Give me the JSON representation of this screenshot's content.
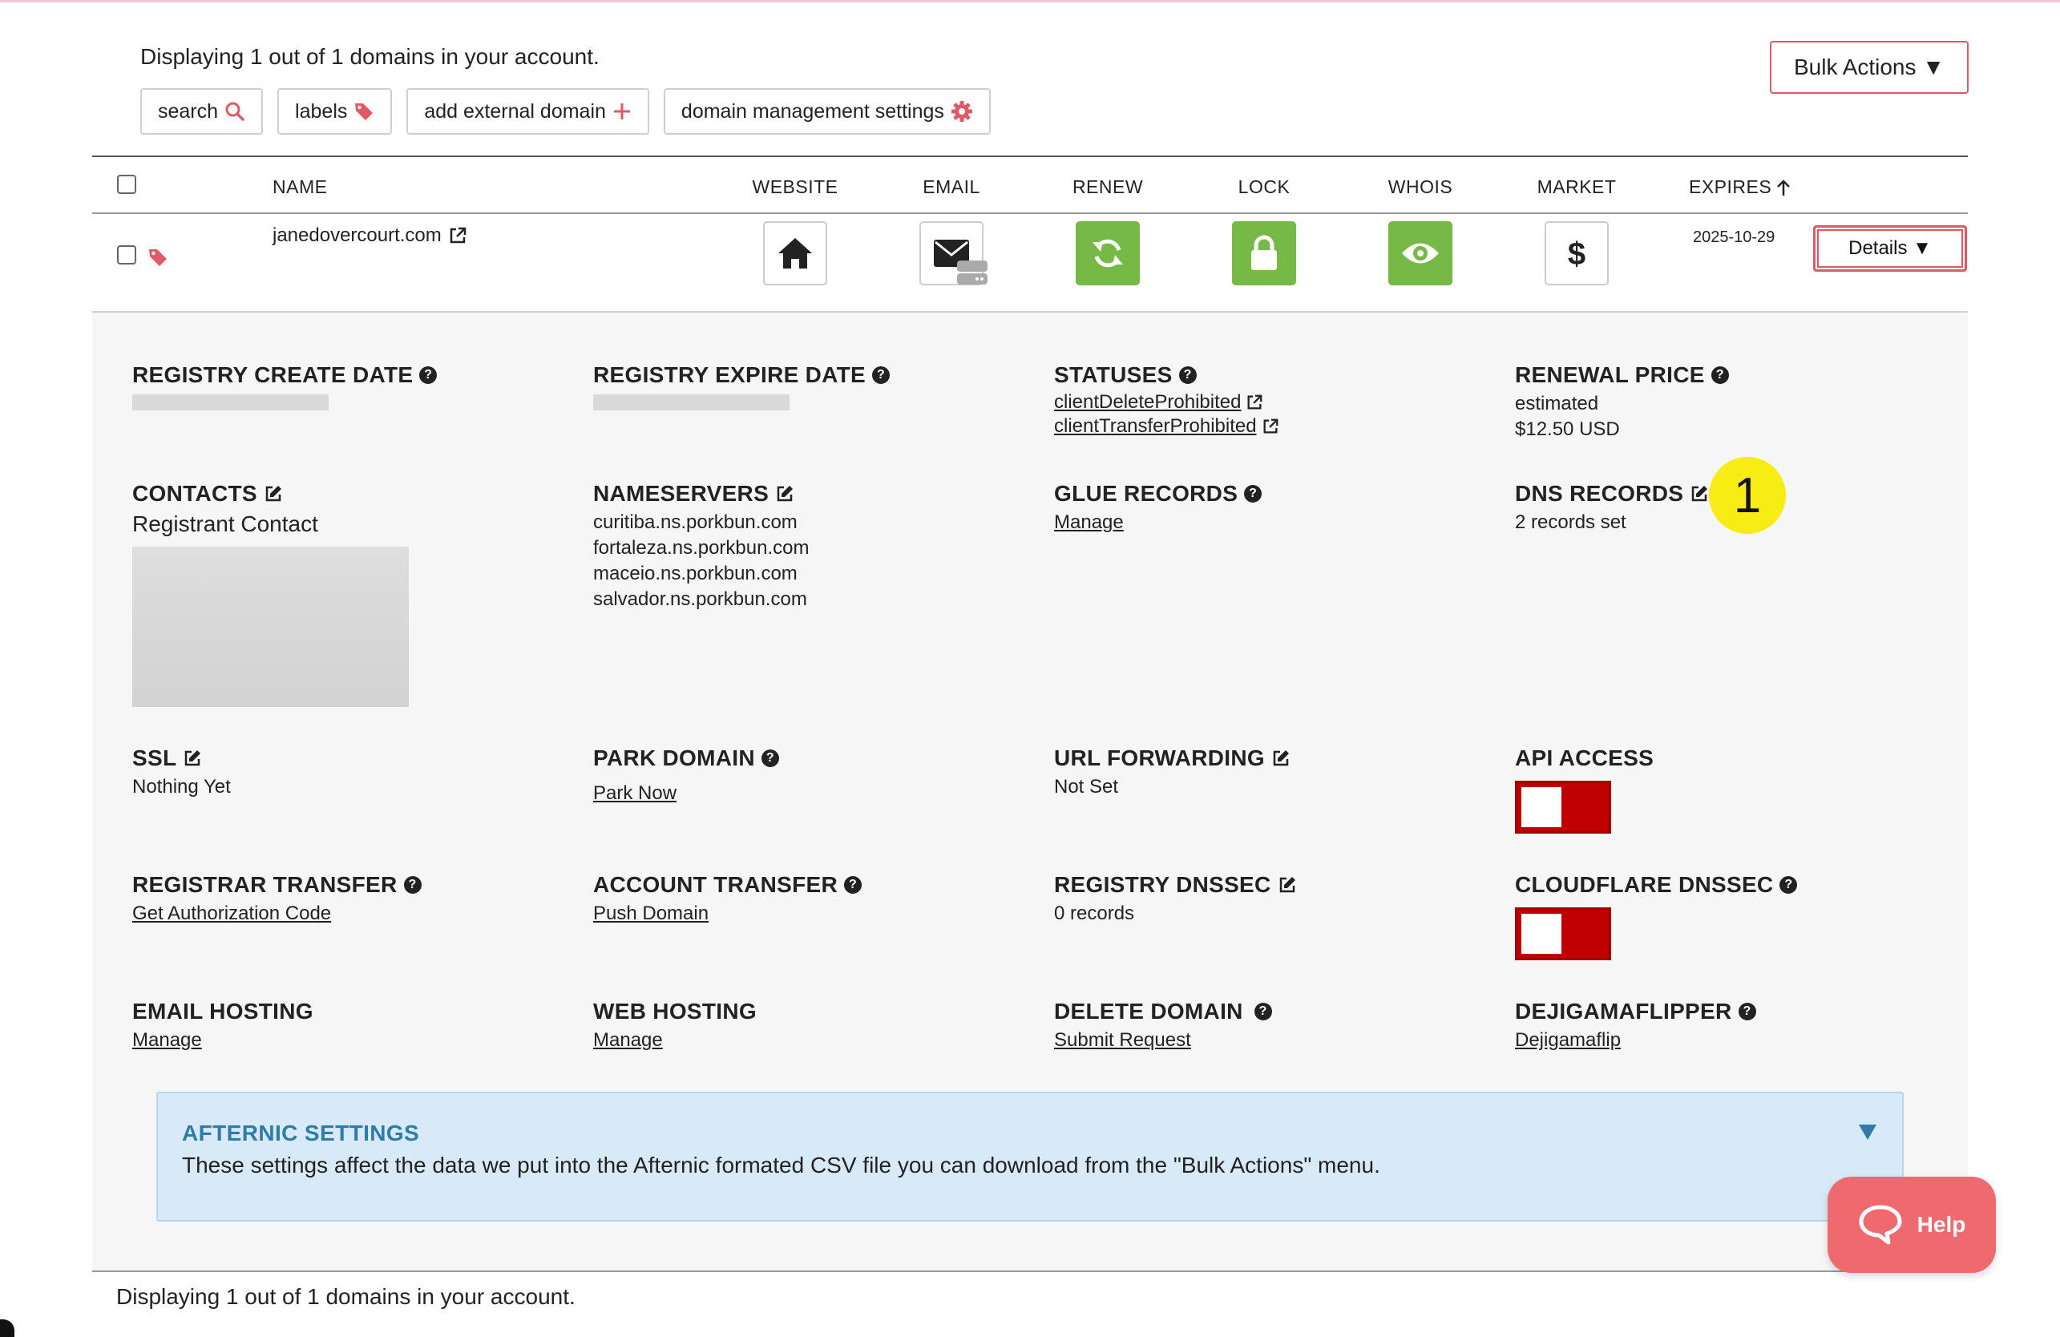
{
  "summary": "Displaying 1 out of 1 domains in your account.",
  "summary_bottom": "Displaying 1 out of 1 domains in your account.",
  "toolbar": {
    "search": "search",
    "labels": "labels",
    "add_external": "add external domain",
    "settings": "domain management settings"
  },
  "bulk_actions": "Bulk Actions ▼",
  "columns": {
    "name": "NAME",
    "website": "WEBSITE",
    "email": "EMAIL",
    "renew": "RENEW",
    "lock": "LOCK",
    "whois": "WHOIS",
    "market": "MARKET",
    "expires": "EXPIRES"
  },
  "domain": {
    "name": "janedovercourt.com",
    "expires": "2025-10-29",
    "details_label": "Details ▼"
  },
  "details": {
    "registry_create_date": "REGISTRY CREATE DATE",
    "registry_expire_date": "REGISTRY EXPIRE DATE",
    "statuses": {
      "title": "STATUSES",
      "items": [
        "clientDeleteProhibited",
        "clientTransferProhibited"
      ]
    },
    "renewal_price": {
      "title": "RENEWAL PRICE",
      "line1": "estimated",
      "line2": "$12.50 USD"
    },
    "contacts": {
      "title": "CONTACTS",
      "sub": "Registrant Contact"
    },
    "nameservers": {
      "title": "NAMESERVERS",
      "items": [
        "curitiba.ns.porkbun.com",
        "fortaleza.ns.porkbun.com",
        "maceio.ns.porkbun.com",
        "salvador.ns.porkbun.com"
      ]
    },
    "glue_records": {
      "title": "GLUE RECORDS",
      "link": "Manage"
    },
    "dns_records": {
      "title": "DNS RECORDS",
      "value": "2 records set"
    },
    "ssl": {
      "title": "SSL",
      "value": "Nothing Yet"
    },
    "park_domain": {
      "title": "PARK DOMAIN",
      "link": "Park Now"
    },
    "url_forwarding": {
      "title": "URL FORWARDING",
      "value": "Not Set"
    },
    "api_access": {
      "title": "API ACCESS",
      "enabled": false
    },
    "registrar_transfer": {
      "title": "REGISTRAR TRANSFER",
      "link": "Get Authorization Code"
    },
    "account_transfer": {
      "title": "ACCOUNT TRANSFER",
      "link": "Push Domain"
    },
    "registry_dnssec": {
      "title": "REGISTRY DNSSEC",
      "value": "0 records"
    },
    "cloudflare_dnssec": {
      "title": "CLOUDFLARE DNSSEC",
      "enabled": false
    },
    "email_hosting": {
      "title": "EMAIL HOSTING",
      "link": "Manage"
    },
    "web_hosting": {
      "title": "WEB HOSTING",
      "link": "Manage"
    },
    "delete_domain": {
      "title": "DELETE DOMAIN",
      "link": "Submit Request"
    },
    "dejigamaflipper": {
      "title": "DEJIGAMAFLIPPER",
      "link": "Dejigamaflip"
    }
  },
  "annotation_badge": "1",
  "afternic": {
    "title": "AFTERNIC SETTINGS",
    "desc": "These settings affect the data we put into the Afternic formated CSV file you can download from the \"Bulk Actions\" menu."
  },
  "help": "Help",
  "colors": {
    "accent_red": "#e05a66",
    "green": "#76b947",
    "toggle_red": "#c00000",
    "afternic_bg": "#d8eaf7",
    "afternic_title": "#2d7da8",
    "badge_yellow": "#f7ec13",
    "help_bg": "#ef6a6f"
  }
}
